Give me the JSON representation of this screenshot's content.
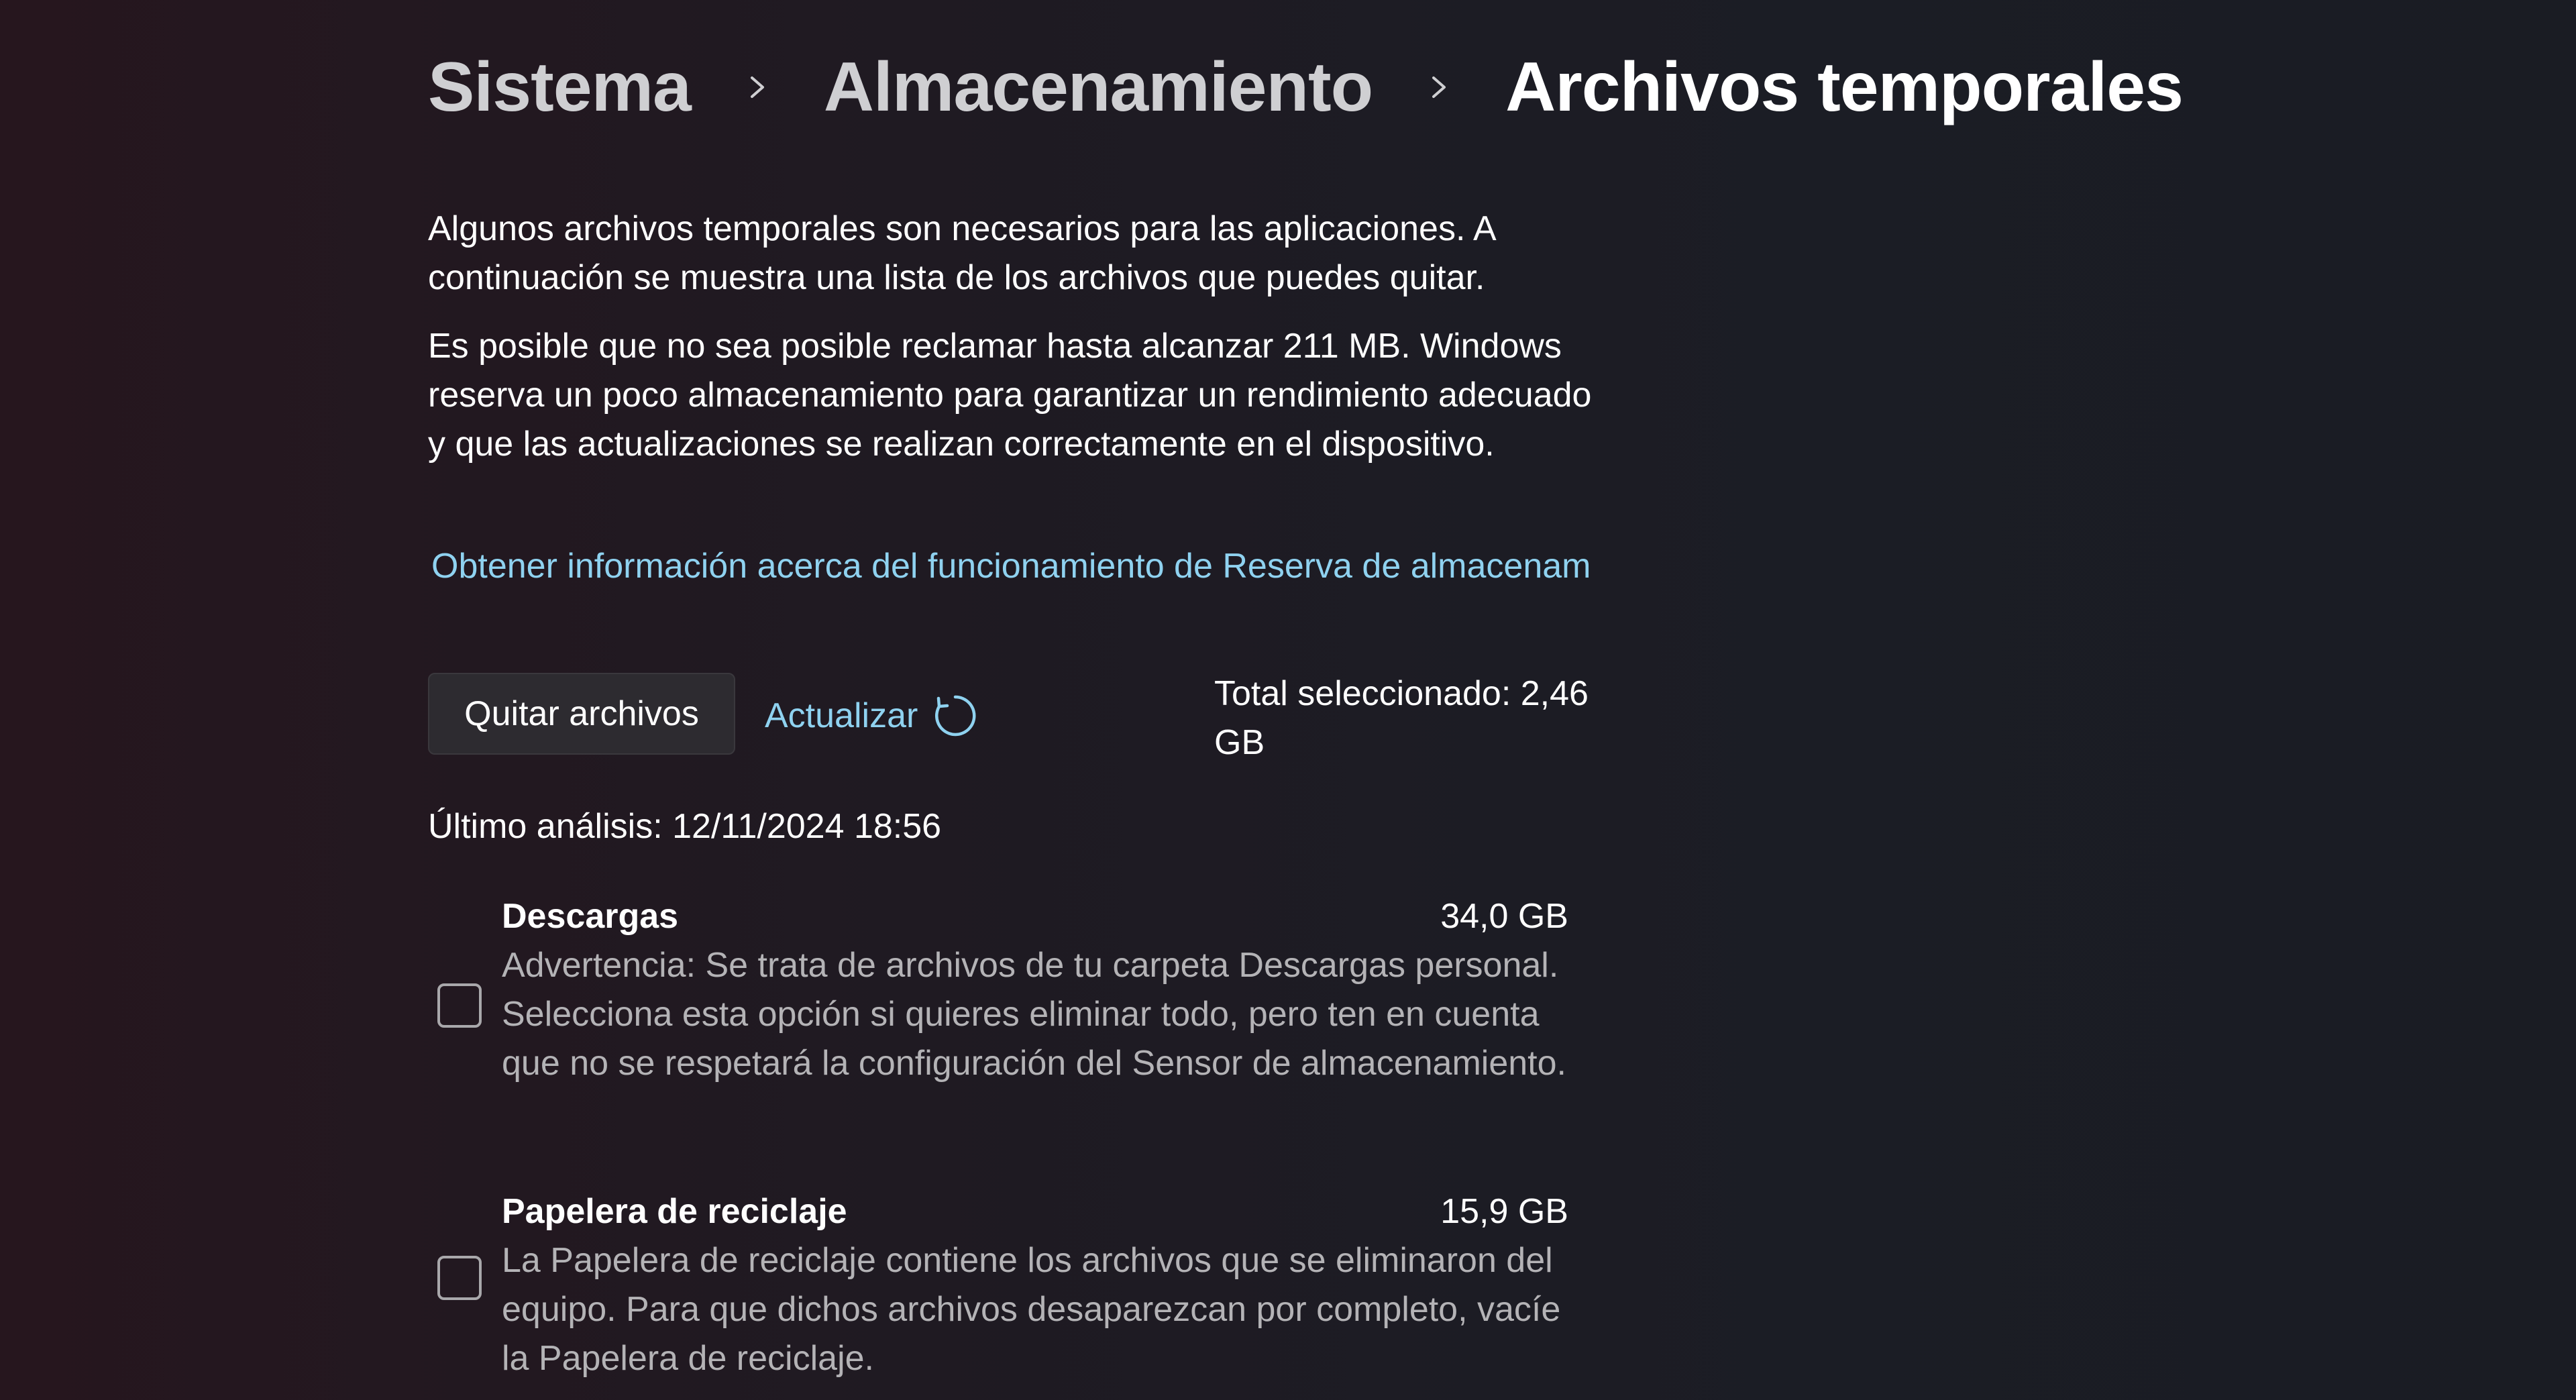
{
  "breadcrumb": {
    "items": [
      "Sistema",
      "Almacenamiento",
      "Archivos temporales"
    ]
  },
  "intro": {
    "paragraph1": "Algunos archivos temporales son necesarios para las aplicaciones. A continuación se muestra una lista de los archivos que puedes quitar.",
    "paragraph2": "Es posible que no sea posible reclamar hasta alcanzar 211 MB. Windows reserva un poco almacenamiento para garantizar un rendimiento adecuado y que las actualizaciones se realizan correctamente en el dispositivo.",
    "learn_link": "Obtener información acerca del funcionamiento de Reserva de almacenamiento"
  },
  "actions": {
    "remove_label": "Quitar archivos",
    "refresh_label": "Actualizar",
    "refresh_icon": "refresh-icon",
    "total_selected": "Total seleccionado: 2,46 GB"
  },
  "last_scan": "Último análisis: 12/11/2024 18:56",
  "items": [
    {
      "title": "Descargas",
      "size": "34,0 GB",
      "description": "Advertencia: Se trata de archivos de tu carpeta Descargas personal. Selecciona esta opción si quieres eliminar todo, pero ten en cuenta que no se respetará la configuración del Sensor de almacenamiento.",
      "checked": false
    },
    {
      "title": "Papelera de reciclaje",
      "size": "15,9 GB",
      "description": "La Papelera de reciclaje contiene los archivos que se eliminaron del equipo. Para que dichos archivos desaparezcan por completo, vacíe la Papelera de reciclaje.",
      "checked": false
    }
  ],
  "colors": {
    "accent_link": "#8fd2f0",
    "text_primary": "#ffffff",
    "text_secondary": "#b4b3b6",
    "button_bg": "#2d2b30"
  }
}
